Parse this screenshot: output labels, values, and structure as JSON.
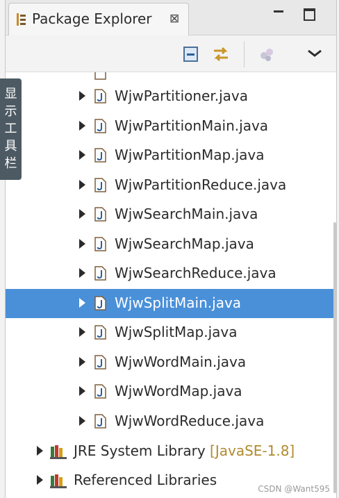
{
  "view": {
    "title": "Package Explorer",
    "close_glyph": "⊠",
    "toolbar": {
      "collapse_all_icon": "collapse-all-icon",
      "link_with_editor_icon": "link-with-editor-icon",
      "filters_icon": "filters-icon",
      "view_menu_icon": "view-menu-chevron-icon"
    }
  },
  "side_tab": {
    "chars": [
      "显",
      "示",
      "工",
      "具",
      "栏"
    ]
  },
  "tree": {
    "files": [
      "WjwPartitioner.java",
      "WjwPartitionMain.java",
      "WjwPartitionMap.java",
      "WjwPartitionReduce.java",
      "WjwSearchMain.java",
      "WjwSearchMap.java",
      "WjwSearchReduce.java",
      "WjwSplitMain.java",
      "WjwSplitMap.java",
      "WjwWordMain.java",
      "WjwWordMap.java",
      "WjwWordReduce.java"
    ],
    "selected_file": "WjwSplitMain.java",
    "jre": {
      "label": "JRE System Library",
      "decoration": "[JavaSE-1.8]"
    },
    "ref_libs": {
      "label": "Referenced Libraries"
    }
  },
  "watermark": "CSDN @Want595",
  "colors": {
    "selection": "#4a90d9",
    "side_tab": "#4d5a63",
    "decoration": "#b08a2e"
  }
}
